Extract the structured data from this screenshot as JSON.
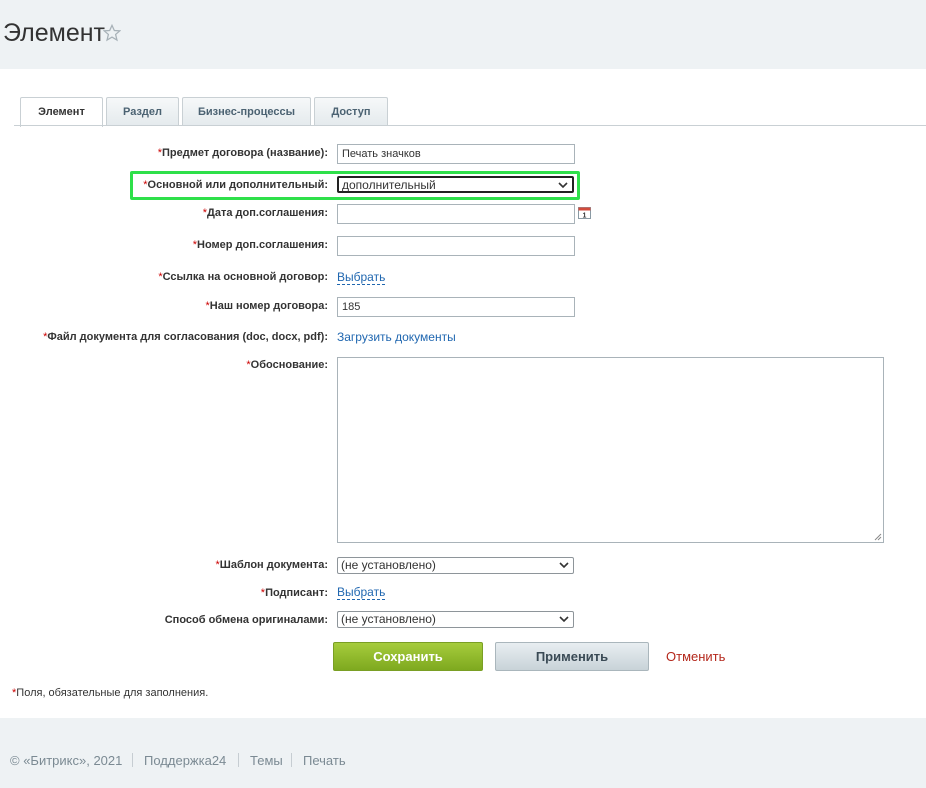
{
  "header": {
    "title": "Элемент",
    "star_icon": "star-icon"
  },
  "tabs": [
    {
      "label": "Элемент",
      "active": true
    },
    {
      "label": "Раздел",
      "active": false
    },
    {
      "label": "Бизнес-процессы",
      "active": false
    },
    {
      "label": "Доступ",
      "active": false
    }
  ],
  "form": {
    "required_mark": "*",
    "subject": {
      "label": "Предмет договора (название):",
      "value": "Печать значков"
    },
    "main_or_additional": {
      "label": "Основной или дополнительный:",
      "value": "дополнительный"
    },
    "agreement_date": {
      "label": "Дата доп.соглашения:",
      "value": "",
      "icon": "calendar-icon"
    },
    "agreement_number": {
      "label": "Номер доп.соглашения:",
      "value": ""
    },
    "main_contract_link": {
      "label": "Ссылка на основной договор:",
      "link": "Выбрать"
    },
    "our_contract_number": {
      "label": "Наш номер договора:",
      "value": "185"
    },
    "document_file": {
      "label": "Файл документа для согласования (doc, docx, pdf):",
      "link": "Загрузить документы"
    },
    "justification": {
      "label": "Обоснование:",
      "value": ""
    },
    "document_template": {
      "label": "Шаблон документа:",
      "value": "(не установлено)"
    },
    "signatory": {
      "label": "Подписант:",
      "link": "Выбрать"
    },
    "originals_exchange": {
      "label": "Способ обмена оригиналами:",
      "value": "(не установлено)"
    }
  },
  "buttons": {
    "save": "Сохранить",
    "apply": "Применить",
    "cancel": "Отменить"
  },
  "required_note": "Поля, обязательные для заполнения.",
  "footer": {
    "copyright": "© «Битрикс», 2021",
    "support": "Поддержка24",
    "themes": "Темы",
    "print": "Печать"
  },
  "colors": {
    "highlight": "#2ee04a",
    "save_button": "#8cb82b",
    "link": "#2067b0",
    "cancel": "#b4281c",
    "required": "#cc0000"
  }
}
